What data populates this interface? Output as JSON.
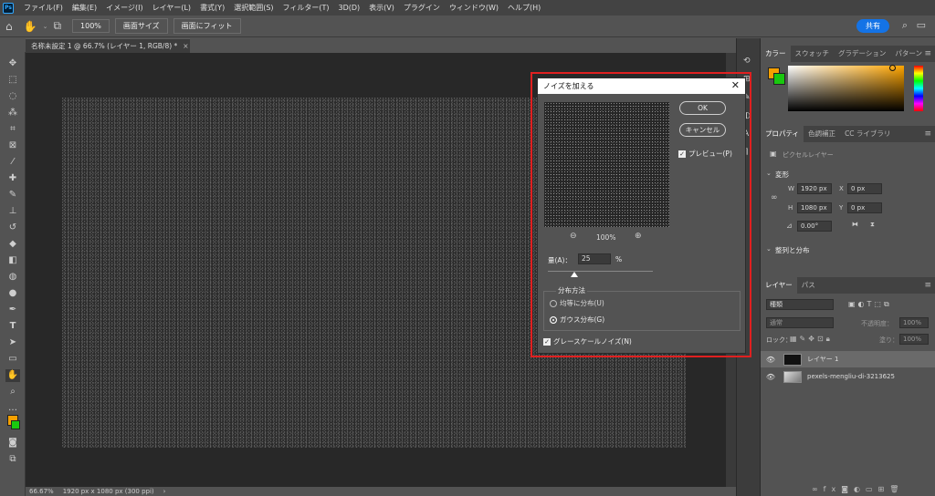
{
  "menubar": {
    "logo": "Ps",
    "items": [
      "ファイル(F)",
      "編集(E)",
      "イメージ(I)",
      "レイヤー(L)",
      "書式(Y)",
      "選択範囲(S)",
      "フィルター(T)",
      "3D(D)",
      "表示(V)",
      "プラグイン",
      "ウィンドウ(W)",
      "ヘルプ(H)"
    ]
  },
  "optbar": {
    "zoom": "100%",
    "fit_screen": "画面サイズ",
    "fill_screen": "画面にフィット",
    "share": "共有"
  },
  "document": {
    "tab_title": "名称未設定 1 @ 66.7% (レイヤー 1, RGB/8) *",
    "close": "×"
  },
  "status": {
    "zoom": "66.67%",
    "size": "1920 px x 1080 px (300 ppi)"
  },
  "panels": {
    "color_tabs": [
      "カラー",
      "スウォッチ",
      "グラデーション",
      "パターン"
    ],
    "fg_color": "#f5a000",
    "bg_color": "#19c80f",
    "prop_tabs": [
      "プロパティ",
      "色調補正",
      "CC ライブラリ"
    ],
    "pixel_layer": "ピクセルレイヤー",
    "transform_title": "変形",
    "w_label": "W",
    "w_value": "1920 px",
    "h_label": "H",
    "h_value": "1080 px",
    "x_label": "X",
    "x_value": "0 px",
    "y_label": "Y",
    "y_value": "0 px",
    "angle": "0.00°",
    "align_title": "整列と分布",
    "layer_tabs": [
      "レイヤー",
      "パス"
    ],
    "search_kind": "種類",
    "blend_mode": "通常",
    "opacity_label": "不透明度：",
    "opacity": "100%",
    "lock_label": "ロック：",
    "fill_label": "塗り：",
    "fill": "100%",
    "layers": [
      "レイヤー 1",
      "pexels-mengliu-di-3213625"
    ]
  },
  "dialog": {
    "title": "ノイズを加える",
    "ok": "OK",
    "cancel": "キャンセル",
    "preview_label": "プレビュー(P)",
    "zoom": "100%",
    "amount_label": "量(A)：",
    "amount_value": "25",
    "amount_unit": "%",
    "amount_fraction": 0.25,
    "distribution_title": "分布方法",
    "uniform": "均等に分布(U)",
    "gaussian": "ガウス分布(G)",
    "mono": "グレースケールノイズ(N)"
  }
}
